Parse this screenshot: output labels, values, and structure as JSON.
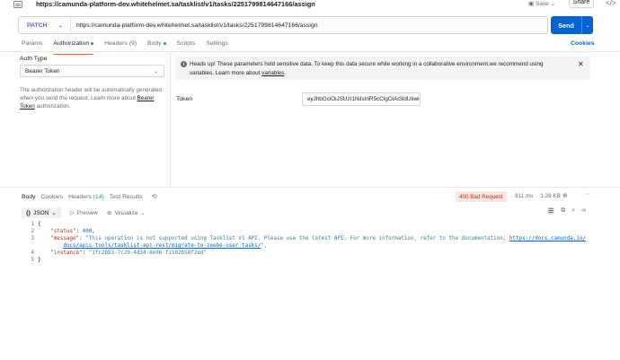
{
  "titlebar": {
    "url": "https://camunda-platform-dev.whitehelmet.sa/tasklist/v1/tasks/2251799814647166/assign",
    "save": "Save",
    "share": "Share"
  },
  "request": {
    "method": "PATCH",
    "url": "https://camunda-platform-dev.whitehelmet.sa/tasklist/v1/tasks/2251799814647166/assign",
    "send": "Send"
  },
  "req_tabs": [
    {
      "label": "Params"
    },
    {
      "label": "Authorization",
      "active": true,
      "dot": true
    },
    {
      "label": "Headers",
      "count": "(9)"
    },
    {
      "label": "Body",
      "dot": true
    },
    {
      "label": "Scripts"
    },
    {
      "label": "Settings"
    }
  ],
  "cookies": "Cookies",
  "auth": {
    "type_label": "Auth Type",
    "type_value": "Bearer Token",
    "desc_prefix": "The authorization header will be automatically generated when you send the request. Learn more about",
    "desc_link": "Bearer Token",
    "desc_suffix": "authorization."
  },
  "notice": {
    "text": "Heads up! These parameters hold sensitive data. To keep this data secure while working in a collaborative environment,we recommend using variables. Learn more about",
    "link": "variables",
    "end": "."
  },
  "token": {
    "label": "Token",
    "value": "eyJhbGciOiJSUzI1NiIsInR5cCIgOiAiSldUIiwi..."
  },
  "response": {
    "tabs": [
      {
        "label": "Body",
        "active": true
      },
      {
        "label": "Cookies"
      },
      {
        "label": "Headers",
        "count": "(14)"
      },
      {
        "label": "Test Results"
      }
    ],
    "status": "400 Bad Request",
    "time": "811 ms",
    "size": "1.28 KB",
    "format": "JSON",
    "preview": "Preview",
    "visualize": "Visualize"
  },
  "code": {
    "lines": [
      "1",
      "2",
      "3",
      "",
      "4",
      "5"
    ],
    "brace_open": "{",
    "brace_close": "}",
    "status_key": "\"status\"",
    "status_val": "400",
    "message_key": "\"message\"",
    "message_val": "\"This operation is not supported using Tasklist V1 API. Please use the latest API. For more information, refer to the documentation: ",
    "message_link1": "https://docs.camunda.io/",
    "message_link2": "docs/apis-tools/tasklist-api-rest/migrate-to-zeebe-user-tasks/",
    "message_end": "\",",
    "instance_key": "\"instance\"",
    "instance_val": "\"1fc2bb3-7c29-4d34-8e96-f1502b58f2ed\""
  }
}
